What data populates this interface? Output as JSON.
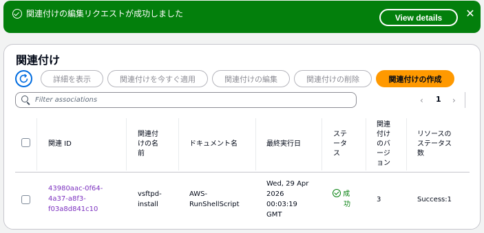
{
  "flash": {
    "message": "関連付けの編集リクエストが成功しました",
    "view_details_label": "View details",
    "close_glyph": "✕"
  },
  "panel": {
    "title": "関連付け",
    "buttons": {
      "details": "詳細を表示",
      "apply_now": "関連付けを今すぐ適用",
      "edit": "関連付けの編集",
      "delete": "関連付けの削除",
      "create": "関連付けの作成"
    },
    "search_placeholder": "Filter associations",
    "pagination": {
      "prev": "‹",
      "current": "1",
      "next": "›"
    }
  },
  "table": {
    "headers": {
      "association_id": "関連 ID",
      "association_name": [
        "関連付",
        "けの名",
        "前"
      ],
      "document_name": "ドキュメント名",
      "last_run": "最終実行日",
      "status": [
        "ステ",
        "ータ",
        "ス"
      ],
      "version": [
        "関連",
        "付け",
        "のバ",
        "ージ",
        "ョン"
      ],
      "resource_status": [
        "リソースの",
        "ステータス",
        "数"
      ]
    },
    "rows": [
      {
        "association_id": [
          "43980aac-0f64-",
          "4a37-a8f3-",
          "f03a8d841c10"
        ],
        "association_name": [
          "vsftpd-",
          "install"
        ],
        "document_name": [
          "AWS-",
          "RunShellScript"
        ],
        "last_run": [
          "Wed, 29 Apr",
          "2026",
          "00:03:19",
          "GMT"
        ],
        "status": [
          "成",
          "功"
        ],
        "version": "3",
        "resource_status": "Success:1"
      }
    ]
  },
  "colors": {
    "success": "#037f0c",
    "primary": "#ff9900",
    "link": "#7b2fbf",
    "accent": "#006ce0"
  },
  "icons": [
    "check-circle-icon",
    "close-icon",
    "refresh-icon",
    "search-icon",
    "chevron-left-icon",
    "chevron-right-icon"
  ]
}
